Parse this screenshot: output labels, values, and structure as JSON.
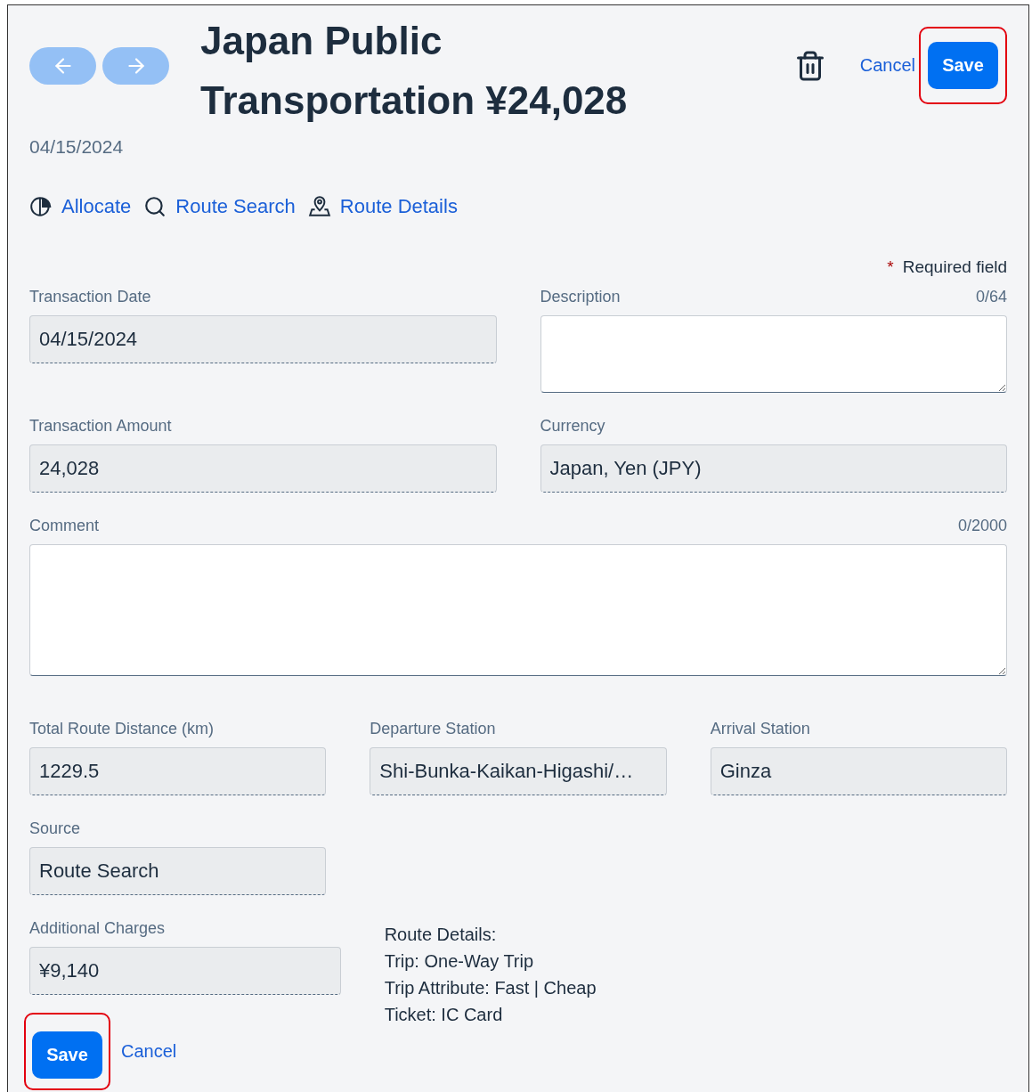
{
  "nav_buttons": [
    {
      "kind": "back"
    },
    {
      "kind": "forward"
    }
  ],
  "title": "Japan Public Transportation ¥24,028",
  "header_actions": {
    "delete": {
      "kind": "trash"
    },
    "cancel": "Cancel",
    "save": {
      "label": "Save",
      "highlighted": true
    }
  },
  "date": "04/15/2024",
  "actions": [
    {
      "kind": "allocate",
      "label": "Allocate"
    },
    {
      "kind": "route-search",
      "label": "Route Search"
    },
    {
      "kind": "route-details",
      "label": "Route Details"
    }
  ],
  "required_note": {
    "mark": "*",
    "text": "Required field"
  },
  "top_fields": [
    {
      "kind": "input",
      "label": "Transaction Date",
      "value": "04/15/2024"
    },
    {
      "kind": "textarea",
      "label": "Description",
      "counter": "0/64"
    },
    {
      "kind": "input",
      "label": "Transaction Amount",
      "value": "24,028"
    },
    {
      "kind": "input",
      "label": "Currency",
      "value": "Japan, Yen (JPY)"
    }
  ],
  "comment": {
    "kind": "textarea",
    "label": "Comment",
    "counter": "0/2000"
  },
  "route_fields": [
    {
      "kind": "input",
      "label": "Total Route Distance (km)",
      "value": "1229.5"
    },
    {
      "kind": "input",
      "label": "Departure Station",
      "value": "Shi-Bunka-Kaikan-Higashi/…"
    },
    {
      "kind": "input",
      "label": "Arrival Station",
      "value": "Ginza"
    }
  ],
  "source": {
    "kind": "input",
    "label": "Source",
    "value": "Route Search"
  },
  "additional_charges": {
    "kind": "input",
    "label": "Additional Charges",
    "value": "¥9,140"
  },
  "route_summary": [
    "Route Details:",
    "Trip: One-Way Trip",
    "Trip Attribute: Fast | Cheap",
    "Ticket: IC Card"
  ],
  "footer_actions": {
    "save": {
      "label": "Save",
      "highlighted": true
    },
    "cancel": "Cancel"
  }
}
